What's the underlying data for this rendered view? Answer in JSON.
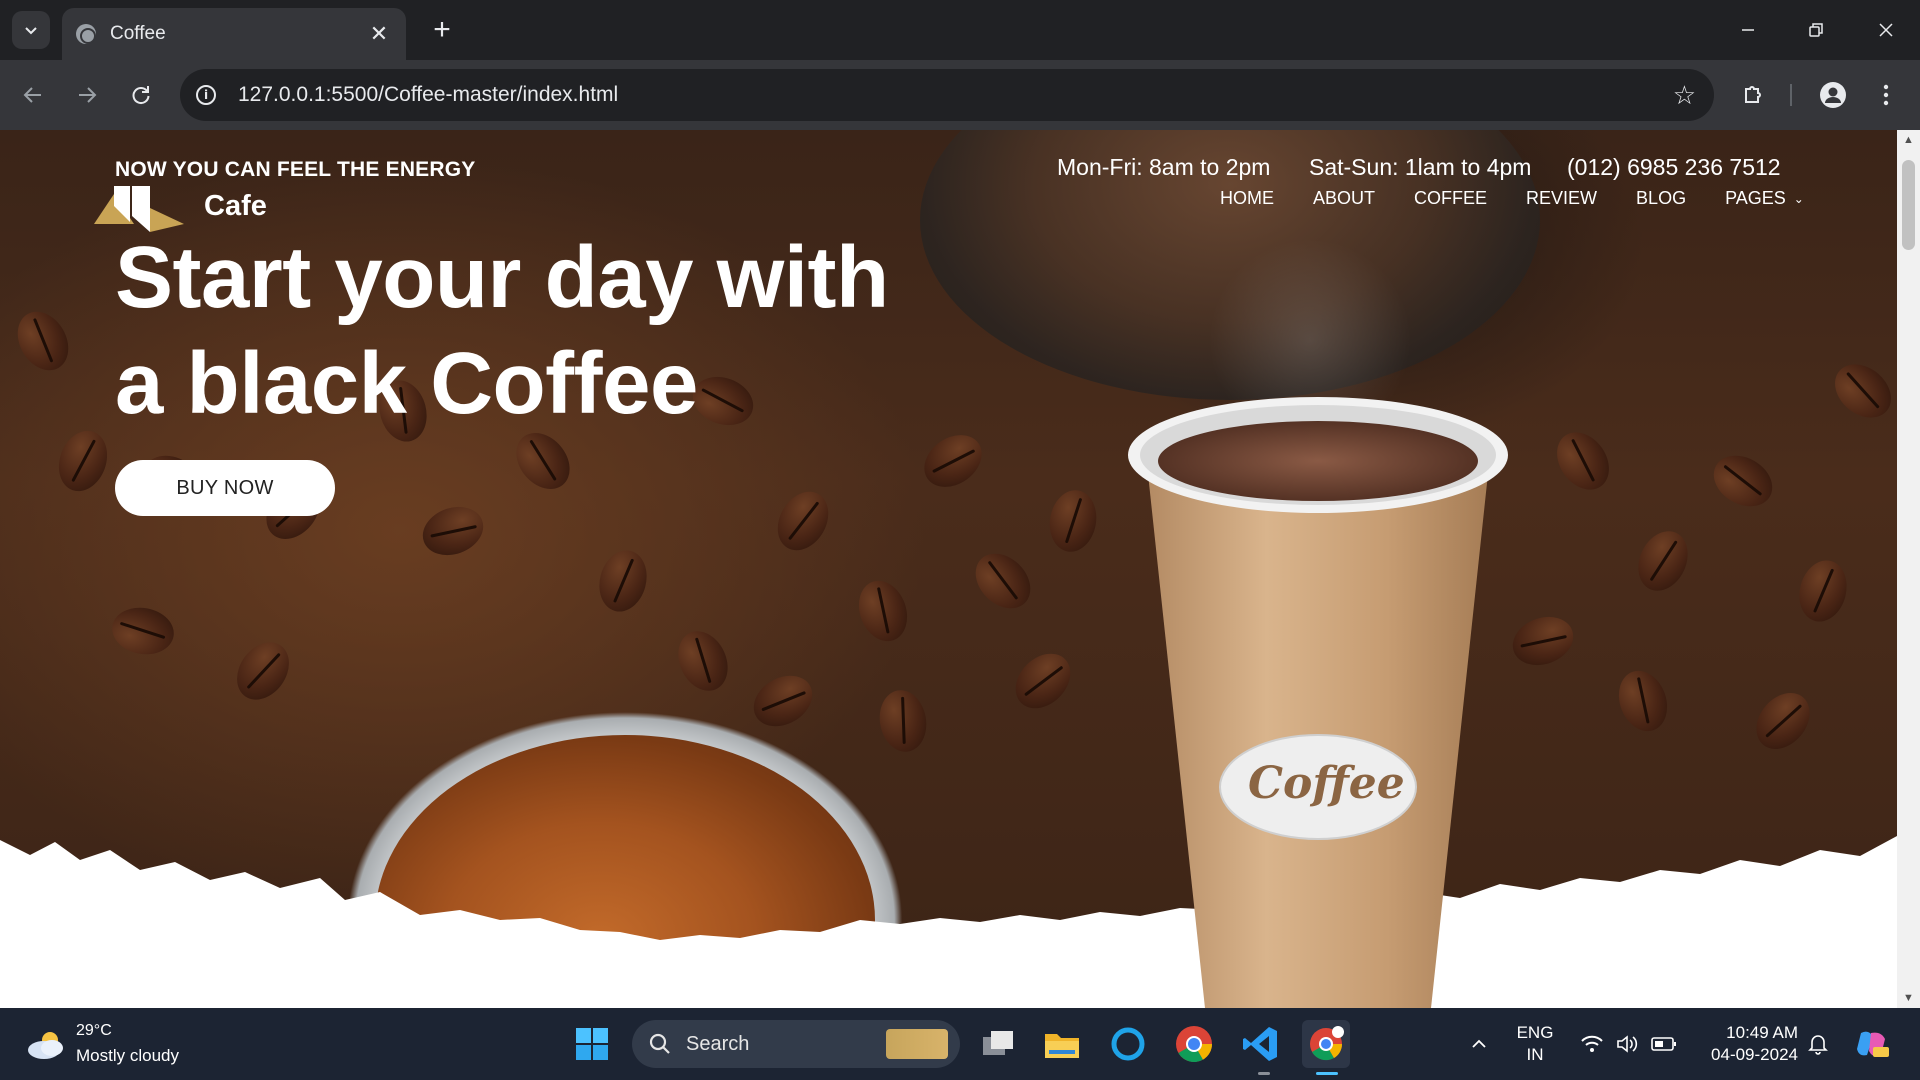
{
  "browser": {
    "tab_title": "Coffee",
    "url_host": "127.0.0.1",
    "url_path": ":5500/Coffee-master/index.html"
  },
  "site": {
    "tagline": "NOW YOU CAN FEEL THE ENERGY",
    "logo_text": "Cafe",
    "headline_line1": "Start your day with",
    "headline_line2": "a black Coffee",
    "cta_label": "BUY NOW",
    "hours_weekday": "Mon-Fri: 8am to 2pm",
    "hours_weekend": "Sat-Sun: 1lam to 4pm",
    "phone": "(012) 6985 236 7512",
    "menu": [
      "HOME",
      "ABOUT",
      "COFFEE",
      "REVIEW",
      "BLOG",
      "PAGES"
    ],
    "cup_label": "Coffee"
  },
  "taskbar": {
    "weather_temp": "29°C",
    "weather_desc": "Mostly cloudy",
    "search_label": "Search",
    "lang_line1": "ENG",
    "lang_line2": "IN",
    "time": "10:49 AM",
    "date": "04-09-2024"
  },
  "colors": {
    "chrome_dark": "#202124",
    "chrome_toolbar": "#35363a",
    "taskbar_bg": "#1c2433",
    "accent_blue": "#4cc2ff",
    "cup_tan": "#c9a27a"
  }
}
